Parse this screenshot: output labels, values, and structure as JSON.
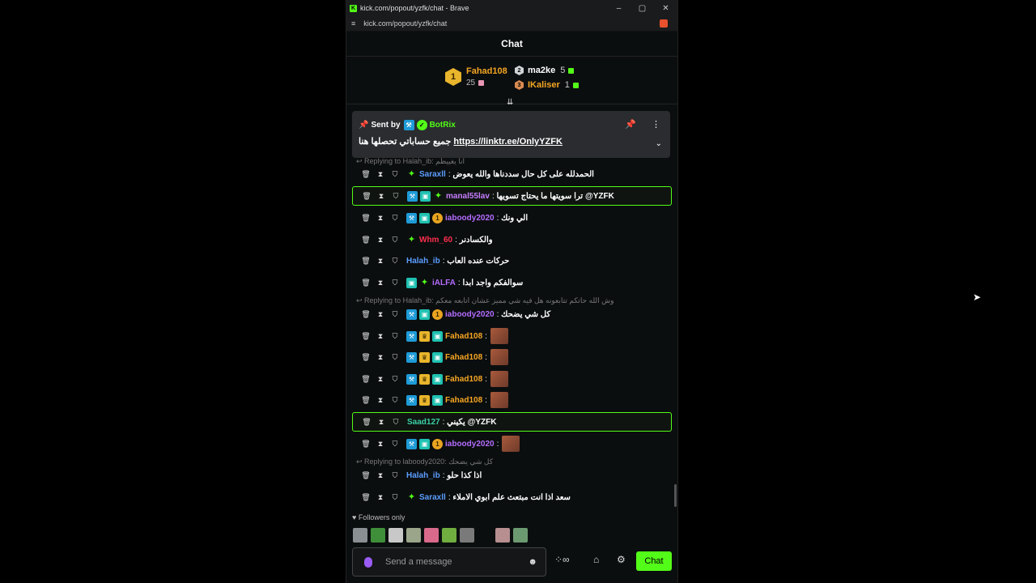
{
  "browser": {
    "title": "kick.com/popout/yzfk/chat - Brave",
    "url": "kick.com/popout/yzfk/chat",
    "min": "–",
    "max": "▢",
    "close": "✕",
    "site_info": "≡",
    "favicon": "K"
  },
  "chat": {
    "header": "Chat",
    "leaderboard": {
      "first": {
        "rank": "1",
        "name": "Fahad108",
        "count": "25"
      },
      "others": [
        {
          "name": "ma2ke",
          "count": "5",
          "color": "#ffffff"
        },
        {
          "name": "IKaliser",
          "count": "1",
          "color": "#f5a623"
        }
      ],
      "collapse": "⇊"
    },
    "pinned": {
      "sent_by": "Sent by",
      "author": "BotRix",
      "text": "جميع حساباتي تحصلها هنا",
      "link": "https://linktr.ee/OnlyYZFK",
      "pin": "📌",
      "menu": "⋮",
      "chevron": "⌄"
    },
    "replies": [
      {
        "text": "Replying to Halah_ib: انا يغييظم"
      },
      {
        "text": "Replying to Halah_ib: وش الله حاتكم تتابعونه هل فيه شي مميز عشان اتابعه معكم"
      },
      {
        "text": "Replying to laboody2020: كل شي يضحك"
      }
    ],
    "messages": [
      {
        "user": "Saraxll",
        "color": "#5b9dff",
        "text": "الحمدلله على كل حال سددناها والله يعوض"
      },
      {
        "user": "manal55lav",
        "color": "#c77dff",
        "text": "ترا سويتها ما يحتاج تسويها @YZFK"
      },
      {
        "user": "iaboody2020",
        "color": "#b36cff",
        "text": "الي ونك"
      },
      {
        "user": "Whm_60",
        "color": "#ff2e4d",
        "text": "والكسادنر"
      },
      {
        "user": "Halah_ib",
        "color": "#5b9dff",
        "text": "حركات عنده العاب"
      },
      {
        "user": "iALFA",
        "color": "#b36cff",
        "text": "سوالفكم واجد ابدا"
      },
      {
        "user": "iaboody2020",
        "color": "#b36cff",
        "text": "كل شي يضحك"
      },
      {
        "user": "Fahad108",
        "color": "#f5a623",
        "text": ""
      },
      {
        "user": "Fahad108",
        "color": "#f5a623",
        "text": ""
      },
      {
        "user": "Fahad108",
        "color": "#f5a623",
        "text": ""
      },
      {
        "user": "Fahad108",
        "color": "#f5a623",
        "text": ""
      },
      {
        "user": "Saad127",
        "color": "#3ad0a6",
        "text": "يكيني @YZFK"
      },
      {
        "user": "iaboody2020",
        "color": "#b36cff",
        "text": ""
      },
      {
        "user": "Halah_ib",
        "color": "#5b9dff",
        "text": "اذا كذا حلو"
      },
      {
        "user": "Saraxll",
        "color": "#5b9dff",
        "text": "سعد اذا انت مبتعث علم ابوي الاملاء"
      }
    ],
    "followers_only": "Followers only",
    "composer": {
      "placeholder": "Send a message"
    },
    "chat_button": "Chat",
    "colors": {
      "accent": "#53fc18",
      "background": "#0b0e0f"
    }
  }
}
